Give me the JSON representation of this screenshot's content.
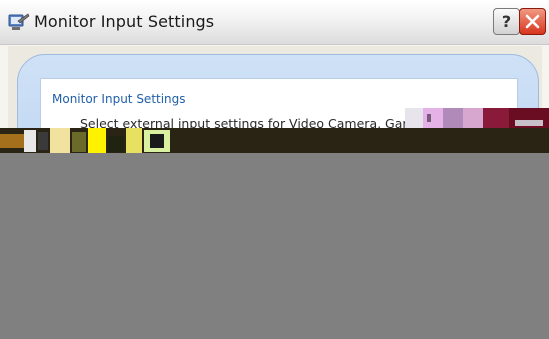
{
  "window": {
    "title": "Monitor Input Settings",
    "help_label": "?"
  },
  "panel": {
    "title": "Monitor Input Settings",
    "description": "Select external input settings for Video Camera, Gam"
  },
  "colors": {
    "title_text": "#1a1a1a",
    "panel_title": "#1f5fa8",
    "frame_blue": "#a9c9ee",
    "close_red": "#d8341c",
    "corruption_gray": "#808080"
  },
  "icons": [
    "settings-app-icon",
    "help-icon",
    "close-icon"
  ]
}
